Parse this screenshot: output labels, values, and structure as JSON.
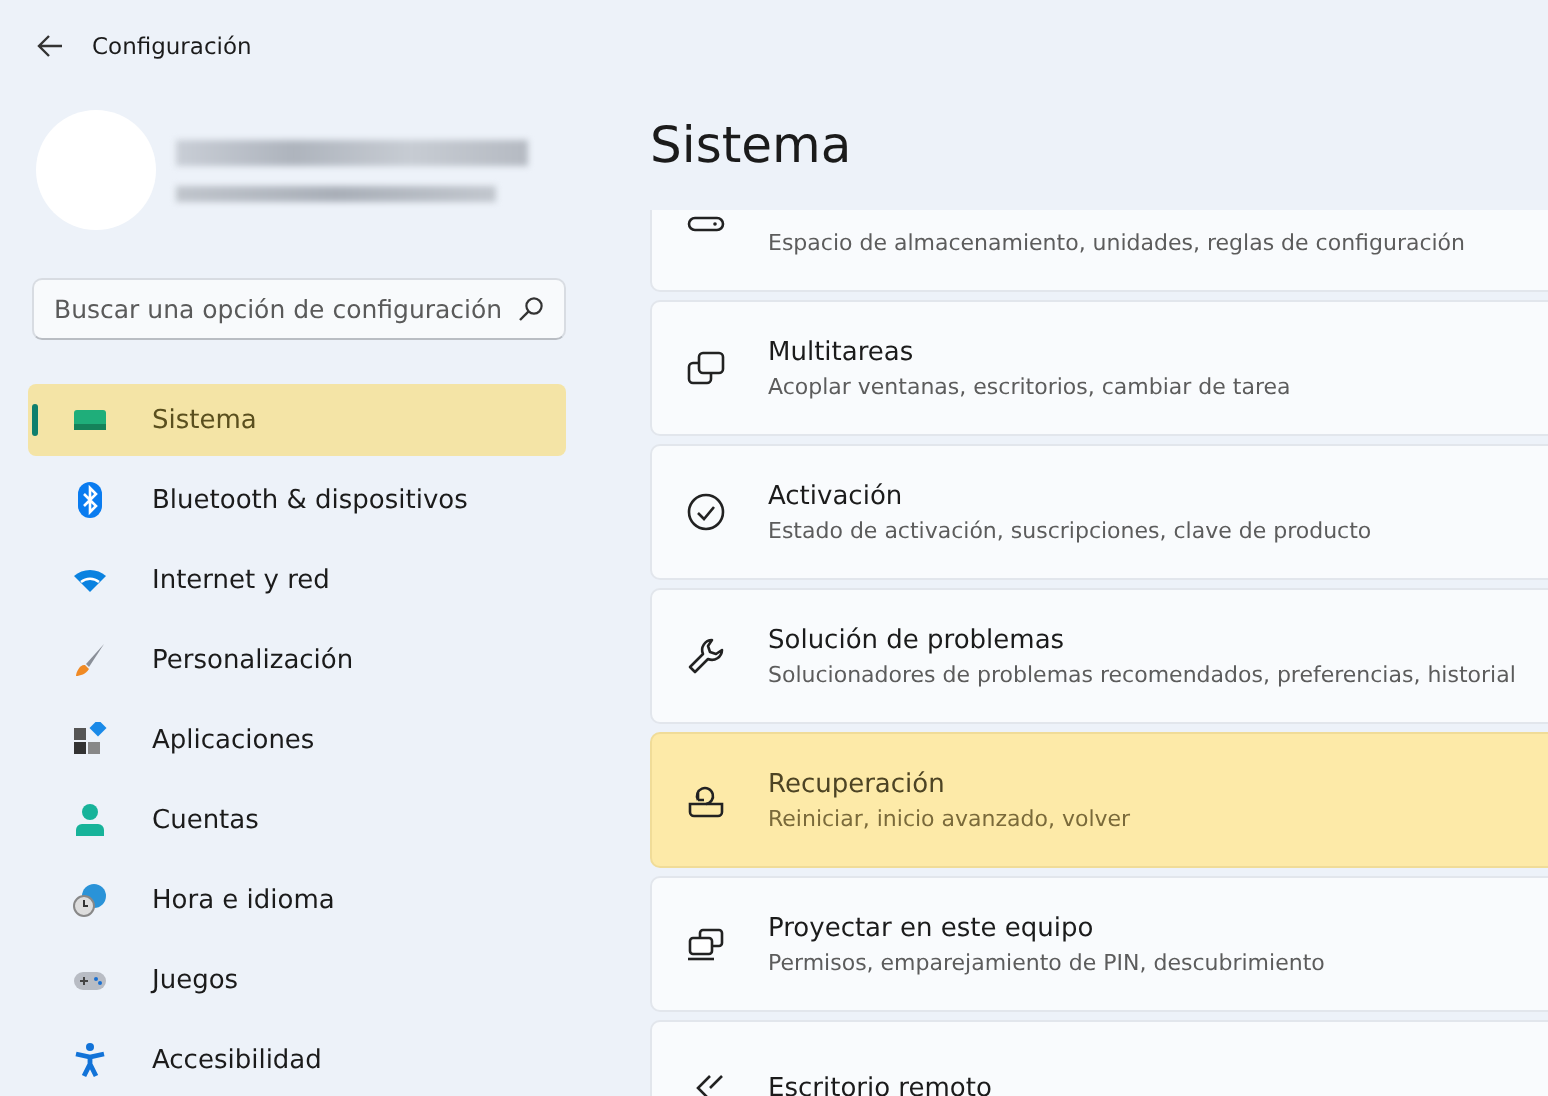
{
  "window": {
    "title": "Configuración"
  },
  "search": {
    "placeholder": "Buscar una opción de configuración"
  },
  "sidebar": {
    "items": [
      {
        "label": "Sistema",
        "selected": true
      },
      {
        "label": "Bluetooth & dispositivos",
        "selected": false
      },
      {
        "label": "Internet y red",
        "selected": false
      },
      {
        "label": "Personalización",
        "selected": false
      },
      {
        "label": "Aplicaciones",
        "selected": false
      },
      {
        "label": "Cuentas",
        "selected": false
      },
      {
        "label": "Hora e idioma",
        "selected": false
      },
      {
        "label": "Juegos",
        "selected": false
      },
      {
        "label": "Accesibilidad",
        "selected": false
      }
    ]
  },
  "page": {
    "title": "Sistema",
    "cards": [
      {
        "description": "Espacio de almacenamiento, unidades, reglas de configuración",
        "highlighted": false
      },
      {
        "title": "Multitareas",
        "description": "Acoplar ventanas, escritorios, cambiar de tarea",
        "highlighted": false
      },
      {
        "title": "Activación",
        "description": "Estado de activación, suscripciones, clave de producto",
        "highlighted": false
      },
      {
        "title": "Solución de problemas",
        "description": "Solucionadores de problemas recomendados, preferencias, historial",
        "highlighted": false
      },
      {
        "title": "Recuperación",
        "description": "Reiniciar, inicio avanzado, volver",
        "highlighted": true
      },
      {
        "title": "Proyectar en este equipo",
        "description": "Permisos, emparejamiento de PIN, descubrimiento",
        "highlighted": false
      },
      {
        "title": "Escritorio remoto",
        "highlighted": false
      }
    ]
  }
}
